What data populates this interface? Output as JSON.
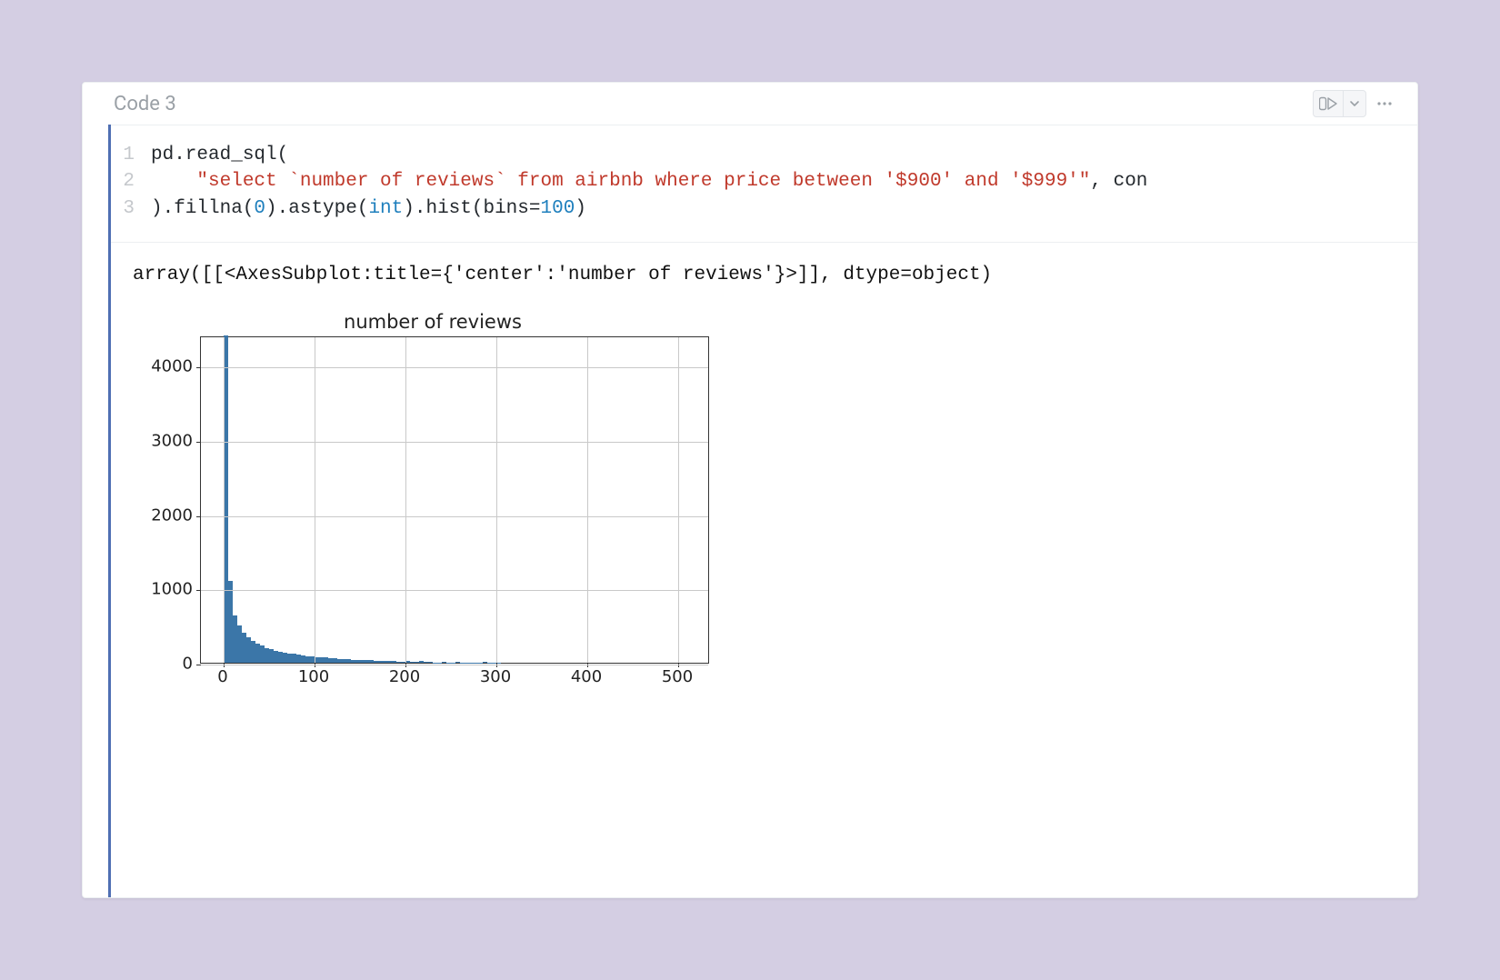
{
  "cell": {
    "label": "Code 3",
    "run_icon": "run-all-icon",
    "dropdown_icon": "chevron-down-icon",
    "more_icon": "more-icon"
  },
  "code": {
    "lines": [
      {
        "n": "1",
        "tokens": [
          [
            "",
            "pd.read_sql("
          ]
        ]
      },
      {
        "n": "2",
        "tokens": [
          [
            "",
            "    "
          ],
          [
            "str",
            "\"select `number of reviews` from airbnb where price between '$900' and '$999'\""
          ],
          [
            "",
            ", con"
          ]
        ]
      },
      {
        "n": "3",
        "tokens": [
          [
            "",
            ").fillna("
          ],
          [
            "num",
            "0"
          ],
          [
            "",
            ").astype("
          ],
          [
            "kw",
            "int"
          ],
          [
            "",
            ").hist(bins="
          ],
          [
            "num",
            "100"
          ],
          [
            "",
            ")"
          ]
        ]
      }
    ]
  },
  "output": {
    "text": "array([[<AxesSubplot:title={'center':'number of reviews'}>]], dtype=object)"
  },
  "chart_data": {
    "type": "bar",
    "title": "number of reviews",
    "xlabel": "",
    "ylabel": "",
    "xlim": [
      -25,
      535
    ],
    "ylim": [
      0,
      4400
    ],
    "xticks": [
      0,
      100,
      200,
      300,
      400,
      500
    ],
    "yticks": [
      0,
      1000,
      2000,
      3000,
      4000
    ],
    "bin_width": 5,
    "x": [
      0,
      5,
      10,
      15,
      20,
      25,
      30,
      35,
      40,
      45,
      50,
      55,
      60,
      65,
      70,
      75,
      80,
      85,
      90,
      95,
      100,
      105,
      110,
      115,
      120,
      125,
      130,
      135,
      140,
      145,
      150,
      155,
      160,
      165,
      170,
      175,
      180,
      185,
      190,
      195,
      200,
      205,
      210,
      215,
      220,
      225,
      230,
      235,
      240,
      245,
      250,
      255,
      260,
      265,
      270,
      275,
      280,
      285,
      290,
      295,
      300
    ],
    "values": [
      4400,
      1100,
      640,
      500,
      400,
      340,
      300,
      260,
      230,
      200,
      180,
      160,
      150,
      140,
      130,
      120,
      110,
      100,
      90,
      85,
      80,
      75,
      70,
      65,
      60,
      55,
      50,
      48,
      45,
      42,
      40,
      38,
      35,
      32,
      30,
      28,
      25,
      22,
      20,
      18,
      25,
      15,
      15,
      22,
      12,
      10,
      8,
      8,
      20,
      6,
      6,
      18,
      5,
      4,
      4,
      6,
      3,
      12,
      3,
      3,
      2
    ]
  }
}
